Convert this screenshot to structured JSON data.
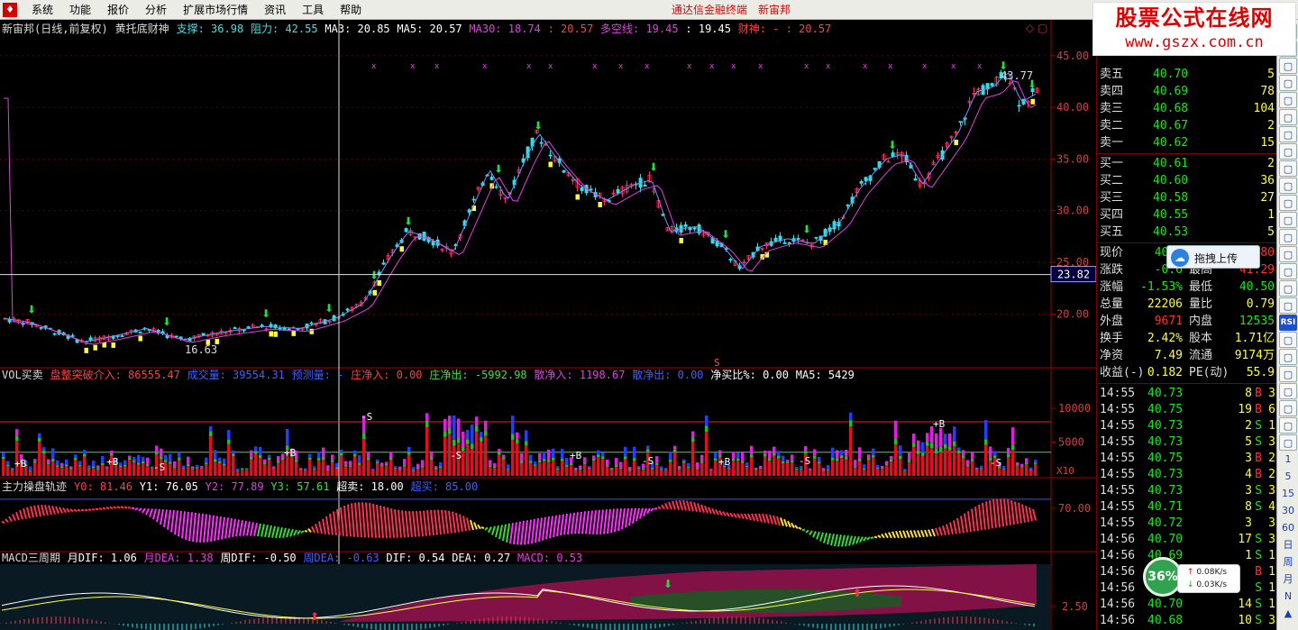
{
  "menu": [
    "系统",
    "功能",
    "报价",
    "分析",
    "扩展市场行情",
    "资讯",
    "工具",
    "帮助"
  ],
  "titlebar": {
    "terminal": "通达信金融终端",
    "stock": "新宙邦"
  },
  "watermark": {
    "line1": "股票公式在线网",
    "line2": "www.gszx.com.cn"
  },
  "main_header": [
    {
      "text": "新宙邦(日线,前复权)",
      "color": "#dcdcdc"
    },
    {
      "text": "黄托底财神",
      "color": "#dcdcdc"
    },
    {
      "text": "支撑: 36.98",
      "color": "#40e0e0"
    },
    {
      "text": "阻力: 42.55",
      "color": "#40e0e0"
    },
    {
      "text": "MA3: 20.85",
      "color": "#ffffff"
    },
    {
      "text": "MA5: 20.57",
      "color": "#ffffff"
    },
    {
      "text": "MA30: 18.74",
      "color": "#e040e0"
    },
    {
      "text": ": 20.57",
      "color": "#ff4040"
    },
    {
      "text": "多空线: 19.45",
      "color": "#e040e0"
    },
    {
      "text": ": 19.45",
      "color": "#ffffff"
    },
    {
      "text": "财神: - : 20.57",
      "color": "#ff4040"
    }
  ],
  "window_buttons": "◇ ▢",
  "price_axis": [
    "45.00",
    "40.00",
    "35.00",
    "30.00",
    "25.00",
    "20.00"
  ],
  "cursor_price": "23.82",
  "high_label": "43.77",
  "low_label": "16.63",
  "marker_s": "S",
  "vol_header": [
    {
      "text": "VOL买卖",
      "color": "#dcdcdc"
    },
    {
      "text": "盘整突破介入: 86555.47",
      "color": "#ff4040"
    },
    {
      "text": "成交量: 39554.31",
      "color": "#4060ff"
    },
    {
      "text": "预测量: -",
      "color": "#4060ff"
    },
    {
      "text": "庄净入: 0.00",
      "color": "#ff4040"
    },
    {
      "text": "庄净出: -5992.98",
      "color": "#40e040"
    },
    {
      "text": "散净入: 1198.67",
      "color": "#e040e0"
    },
    {
      "text": "散净出: 0.00",
      "color": "#4060ff"
    },
    {
      "text": "净买比%: 0.00",
      "color": "#ffffff"
    },
    {
      "text": "MA5: 5429",
      "color": "#ffffff"
    }
  ],
  "vol_axis": [
    "10000",
    "5000"
  ],
  "vol_unit": "X10",
  "vol_markers": [
    "+B",
    "-S"
  ],
  "osc_header": [
    {
      "text": "主力操盘轨迹",
      "color": "#dcdcdc"
    },
    {
      "text": "Y0: 81.46",
      "color": "#ff4040"
    },
    {
      "text": "Y1: 76.05",
      "color": "#ffffff"
    },
    {
      "text": "Y2: 77.89",
      "color": "#e040e0"
    },
    {
      "text": "Y3: 57.61",
      "color": "#40e040"
    },
    {
      "text": "超卖: 18.00",
      "color": "#ffffff"
    },
    {
      "text": "超买: 85.00",
      "color": "#4060ff"
    }
  ],
  "osc_axis": [
    "70.00"
  ],
  "macd_header": [
    {
      "text": "MACD三周期",
      "color": "#dcdcdc"
    },
    {
      "text": "月DIF: 1.06",
      "color": "#ffffff"
    },
    {
      "text": "月DEA: 1.38",
      "color": "#e040e0"
    },
    {
      "text": "周DIF: -0.50",
      "color": "#ffffff"
    },
    {
      "text": "周DEA: -0.63",
      "color": "#4060ff"
    },
    {
      "text": "DIF: 0.54",
      "color": "#ffffff"
    },
    {
      "text": "DEA: 0.27",
      "color": "#ffffff"
    },
    {
      "text": "MACD: 0.53",
      "color": "#e040e0"
    }
  ],
  "macd_axis": [
    "2.50"
  ],
  "quote": {
    "asks": [
      {
        "label": "卖五",
        "price": "40.70",
        "vol": "5"
      },
      {
        "label": "卖四",
        "price": "40.69",
        "vol": "78"
      },
      {
        "label": "卖三",
        "price": "40.68",
        "vol": "104"
      },
      {
        "label": "卖二",
        "price": "40.67",
        "vol": "2"
      },
      {
        "label": "卖一",
        "price": "40.62",
        "vol": "15"
      }
    ],
    "bids": [
      {
        "label": "买一",
        "price": "40.61",
        "vol": "2"
      },
      {
        "label": "买二",
        "price": "40.60",
        "vol": "36"
      },
      {
        "label": "买三",
        "price": "40.58",
        "vol": "27"
      },
      {
        "label": "买四",
        "price": "40.55",
        "vol": "1"
      },
      {
        "label": "买五",
        "price": "40.53",
        "vol": "5"
      }
    ],
    "stats": [
      {
        "l1": "现价",
        "v1": "40.6",
        "c1": "#19e619",
        "l2": "今开",
        "v2": "41.80",
        "c2": "#ff3030"
      },
      {
        "l1": "涨跌",
        "v1": "-0.6",
        "c1": "#19e619",
        "l2": "最高",
        "v2": "41.29",
        "c2": "#ff3030"
      },
      {
        "l1": "涨幅",
        "v1": "-1.53%",
        "c1": "#19e619",
        "l2": "最低",
        "v2": "40.50",
        "c2": "#19e619"
      },
      {
        "l1": "总量",
        "v1": "22206",
        "c1": "#ffff33",
        "l2": "量比",
        "v2": "0.79",
        "c2": "#ffff33"
      },
      {
        "l1": "外盘",
        "v1": "9671",
        "c1": "#ff3030",
        "l2": "内盘",
        "v2": "12535",
        "c2": "#19e619"
      },
      {
        "l1": "换手",
        "v1": "2.42%",
        "c1": "#ffff33",
        "l2": "股本",
        "v2": "1.71亿",
        "c2": "#ffff33"
      },
      {
        "l1": "净资",
        "v1": "7.49",
        "c1": "#ffff33",
        "l2": "流通",
        "v2": "9174万",
        "c2": "#ffff33"
      },
      {
        "l1": "收益(-)",
        "v1": "0.182",
        "c1": "#ffff33",
        "l2": "PE(动)",
        "v2": "55.9",
        "c2": "#ffff33"
      }
    ],
    "ticks": [
      {
        "t": "14:55",
        "p": "40.73",
        "v": "8",
        "f": "B",
        "n": "3"
      },
      {
        "t": "14:55",
        "p": "40.75",
        "v": "19",
        "f": "B",
        "n": "6"
      },
      {
        "t": "14:55",
        "p": "40.73",
        "v": "2",
        "f": "S",
        "n": "1"
      },
      {
        "t": "14:55",
        "p": "40.73",
        "v": "5",
        "f": "S",
        "n": "3"
      },
      {
        "t": "14:55",
        "p": "40.75",
        "v": "3",
        "f": "B",
        "n": "2"
      },
      {
        "t": "14:55",
        "p": "40.73",
        "v": "4",
        "f": "B",
        "n": "2"
      },
      {
        "t": "14:55",
        "p": "40.73",
        "v": "3",
        "f": "S",
        "n": "3"
      },
      {
        "t": "14:55",
        "p": "40.71",
        "v": "8",
        "f": "S",
        "n": "4"
      },
      {
        "t": "14:55",
        "p": "40.72",
        "v": "3",
        "f": "",
        "n": "3"
      },
      {
        "t": "14:56",
        "p": "40.70",
        "v": "17",
        "f": "S",
        "n": "3"
      },
      {
        "t": "14:56",
        "p": "40.69",
        "v": "1",
        "f": "S",
        "n": "1"
      },
      {
        "t": "14:56",
        "p": "40.70",
        "v": "",
        "f": "B",
        "n": "1"
      },
      {
        "t": "14:56",
        "p": "40.70",
        "v": "",
        "f": "S",
        "n": "1"
      },
      {
        "t": "14:56",
        "p": "40.70",
        "v": "14",
        "f": "S",
        "n": "1"
      },
      {
        "t": "14:56",
        "p": "40.68",
        "v": "10",
        "f": "S",
        "n": "3"
      }
    ]
  },
  "side_tools": [
    "▢",
    "▢",
    "▢",
    "▢",
    "▢",
    "▢",
    "▢",
    "▢",
    "▢",
    "▢",
    "▢",
    "▢",
    "▢",
    "▢",
    "▢",
    "▢",
    "▢",
    "RSI",
    "▢",
    "▢",
    "▢",
    "▢",
    "▢",
    "▢",
    "▢",
    "1",
    "5",
    "15",
    "30",
    "60",
    "日",
    "周",
    "月",
    "N",
    "▲"
  ],
  "upload_label": "拖拽上传",
  "speed": {
    "percent": "36%",
    "up": "0.08K/s",
    "down": "0.03K/s"
  },
  "colors": {
    "up": "#ff3060",
    "down": "#30e0e0",
    "bg": "#000000",
    "axis": "#a00000",
    "yellow": "#ffff33"
  }
}
